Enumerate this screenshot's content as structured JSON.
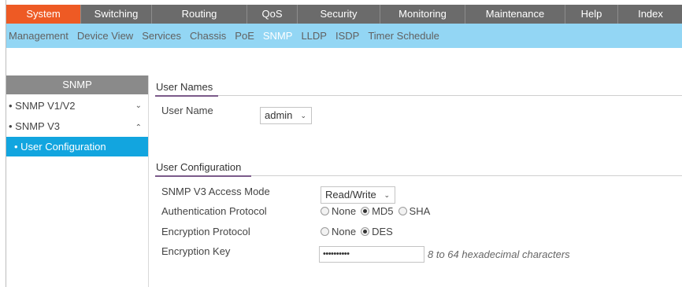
{
  "top_nav": {
    "tabs": [
      {
        "label": "System",
        "active": true
      },
      {
        "label": "Switching",
        "active": false
      },
      {
        "label": "Routing",
        "active": false
      },
      {
        "label": "QoS",
        "active": false
      },
      {
        "label": "Security",
        "active": false
      },
      {
        "label": "Monitoring",
        "active": false
      },
      {
        "label": "Maintenance",
        "active": false
      },
      {
        "label": "Help",
        "active": false
      },
      {
        "label": "Index",
        "active": false
      }
    ]
  },
  "sub_nav": {
    "items": [
      {
        "label": "Management",
        "active": false
      },
      {
        "label": "Device View",
        "active": false
      },
      {
        "label": "Services",
        "active": false
      },
      {
        "label": "Chassis",
        "active": false
      },
      {
        "label": "PoE",
        "active": false
      },
      {
        "label": "SNMP",
        "active": true
      },
      {
        "label": "LLDP",
        "active": false
      },
      {
        "label": "ISDP",
        "active": false
      },
      {
        "label": "Timer Schedule",
        "active": false
      }
    ]
  },
  "sidebar": {
    "header": "SNMP",
    "items": [
      {
        "label": "• SNMP V1/V2",
        "chevron": "⌄"
      },
      {
        "label": "• SNMP V3",
        "chevron": "⌃"
      },
      {
        "label": "• User Configuration",
        "selected": true
      }
    ]
  },
  "user_names": {
    "title": "User Names",
    "user_name_label": "User Name",
    "user_name_value": "admin"
  },
  "user_config": {
    "title": "User Configuration",
    "access_mode_label": "SNMP V3 Access Mode",
    "access_mode_value": "Read/Write",
    "auth_protocol_label": "Authentication Protocol",
    "auth_options": [
      {
        "label": "None",
        "checked": false
      },
      {
        "label": "MD5",
        "checked": true
      },
      {
        "label": "SHA",
        "checked": false
      }
    ],
    "encryption_protocol_label": "Encryption Protocol",
    "encryption_options": [
      {
        "label": "None",
        "checked": false
      },
      {
        "label": "DES",
        "checked": true
      }
    ],
    "encryption_key_label": "Encryption Key",
    "encryption_key_value": "••••••••••",
    "encryption_key_hint": "8 to 64 hexadecimal characters"
  },
  "colors": {
    "active_tab": "#ee5a24",
    "top_nav_bg": "#6b6b6b",
    "sub_nav_bg": "#93d6f4",
    "sidebar_selected": "#12a5df",
    "section_underline": "#7b5a8a"
  },
  "icons": {
    "chevron_down": "chevron-down-icon",
    "chevron_up": "chevron-up-icon"
  }
}
